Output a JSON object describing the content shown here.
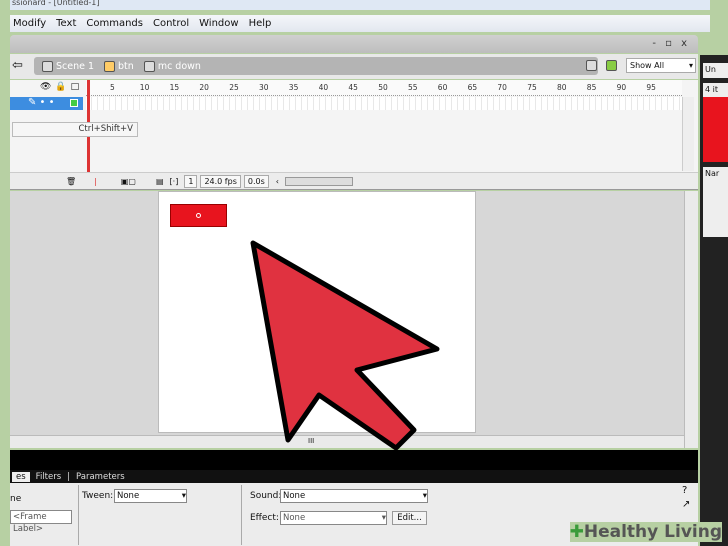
{
  "title": "ssionard - [Untitled-1]",
  "menu": [
    "Modify",
    "Text",
    "Commands",
    "Control",
    "Window",
    "Help"
  ],
  "window_controls": "- ▫ x",
  "breadcrumbs": [
    "Scene 1",
    "btn",
    "mc down"
  ],
  "view": {
    "zoom_select": "Show All"
  },
  "timeline": {
    "ruler": [
      "5",
      "10",
      "15",
      "20",
      "25",
      "30",
      "35",
      "40",
      "45",
      "50",
      "55",
      "60",
      "65",
      "70",
      "75",
      "80",
      "85",
      "90",
      "95"
    ],
    "tooltip": "Ctrl+Shift+V",
    "frame": "1",
    "fps": "24.0 fps",
    "time": "0.0s"
  },
  "properties": {
    "tabs": [
      "es",
      "Filters",
      "Parameters"
    ],
    "frame_heading": "ne",
    "frame_label_placeholder": "<Frame Label>",
    "tween_label": "Tween:",
    "tween_value": "None",
    "sound_label": "Sound:",
    "sound_value": "None",
    "effect_label": "Effect:",
    "effect_value": "None",
    "edit_button": "Edit..."
  },
  "library": {
    "tab": "Un",
    "count": "4 it",
    "name_col": "Nar"
  },
  "watermark": "Healthy Living",
  "colors": {
    "cursor": "#e03240",
    "symbol": "#e8141e",
    "layer_selected": "#3d8de0"
  }
}
